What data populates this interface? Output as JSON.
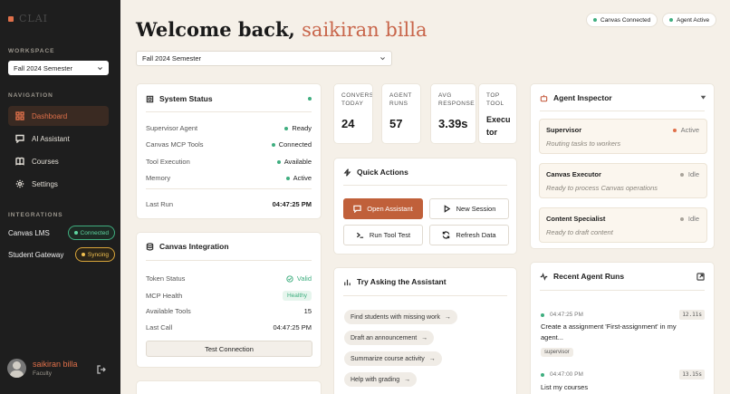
{
  "sidebar": {
    "logo": "CLAI",
    "workspace_label": "WORKSPACE",
    "workspace_value": "Fall 2024 Semester",
    "navigation_label": "NAVIGATION",
    "nav": [
      {
        "label": "Dashboard",
        "icon": "grid-icon",
        "active": true
      },
      {
        "label": "AI Assistant",
        "icon": "chat-icon"
      },
      {
        "label": "Courses",
        "icon": "book-icon"
      },
      {
        "label": "Settings",
        "icon": "gear-icon"
      }
    ],
    "integrations_label": "INTEGRATIONS",
    "integrations": [
      {
        "label": "Canvas LMS",
        "status": "Connected"
      },
      {
        "label": "Student Gateway",
        "status": "Syncing"
      }
    ],
    "user": {
      "name": "saikiran billa",
      "role": "Faculty"
    }
  },
  "header": {
    "welcome_prefix": "Welcome back,",
    "user_name": "saikiran billa",
    "canvas_status": "Canvas Connected",
    "agent_status": "Agent Active",
    "semester_value": "Fall 2024 Semester"
  },
  "system_status": {
    "title": "System Status",
    "rows": [
      {
        "label": "Supervisor Agent",
        "value": "Ready"
      },
      {
        "label": "Canvas MCP Tools",
        "value": "Connected"
      },
      {
        "label": "Tool Execution",
        "value": "Available"
      },
      {
        "label": "Memory",
        "value": "Active"
      }
    ],
    "last_run_label": "Last Run",
    "last_run_value": "04:47:25 PM"
  },
  "stats": [
    {
      "label": "CONVERSATIONS\nTODAY",
      "value": "24"
    },
    {
      "label": "AGENT\nRUNS",
      "value": "57"
    },
    {
      "label": "AVG\nRESPONSE",
      "value": "3.39s"
    },
    {
      "label": "TOP\nTOOL",
      "value": "Execu\ntor"
    }
  ],
  "quick_actions": {
    "title": "Quick Actions",
    "open_assistant": "Open Assistant",
    "new_session": "New Session",
    "run_tool_test": "Run Tool Test",
    "refresh_data": "Refresh Data"
  },
  "canvas_integration": {
    "title": "Canvas Integration",
    "token_status_label": "Token Status",
    "token_status_value": "Valid",
    "mcp_health_label": "MCP Health",
    "mcp_health_value": "Healthy",
    "available_tools_label": "Available Tools",
    "available_tools_value": "15",
    "last_call_label": "Last Call",
    "last_call_value": "04:47:25 PM",
    "test_button": "Test Connection"
  },
  "try_asking": {
    "title": "Try Asking the Assistant",
    "prompts": [
      "Find students with missing work",
      "Draft an announcement",
      "Summarize course activity",
      "Help with grading"
    ]
  },
  "agent_inspector": {
    "title": "Agent Inspector",
    "agents": [
      {
        "name": "Supervisor",
        "status": "Active",
        "desc": "Routing tasks to workers",
        "color": "#e0704a"
      },
      {
        "name": "Canvas Executor",
        "status": "Idle",
        "desc": "Ready to process Canvas operations",
        "color": "#a8a39a"
      },
      {
        "name": "Content Specialist",
        "status": "Idle",
        "desc": "Ready to draft content",
        "color": "#a8a39a"
      }
    ]
  },
  "recent_runs": {
    "title": "Recent Agent Runs",
    "runs": [
      {
        "time": "04:47:25 PM",
        "duration": "12.11s",
        "text": "Create a assignment 'First-assignment' in my agent...",
        "tag": "supervisor"
      },
      {
        "time": "04:47:00 PM",
        "duration": "13.15s",
        "text": "List my courses",
        "tag": ""
      }
    ]
  }
}
